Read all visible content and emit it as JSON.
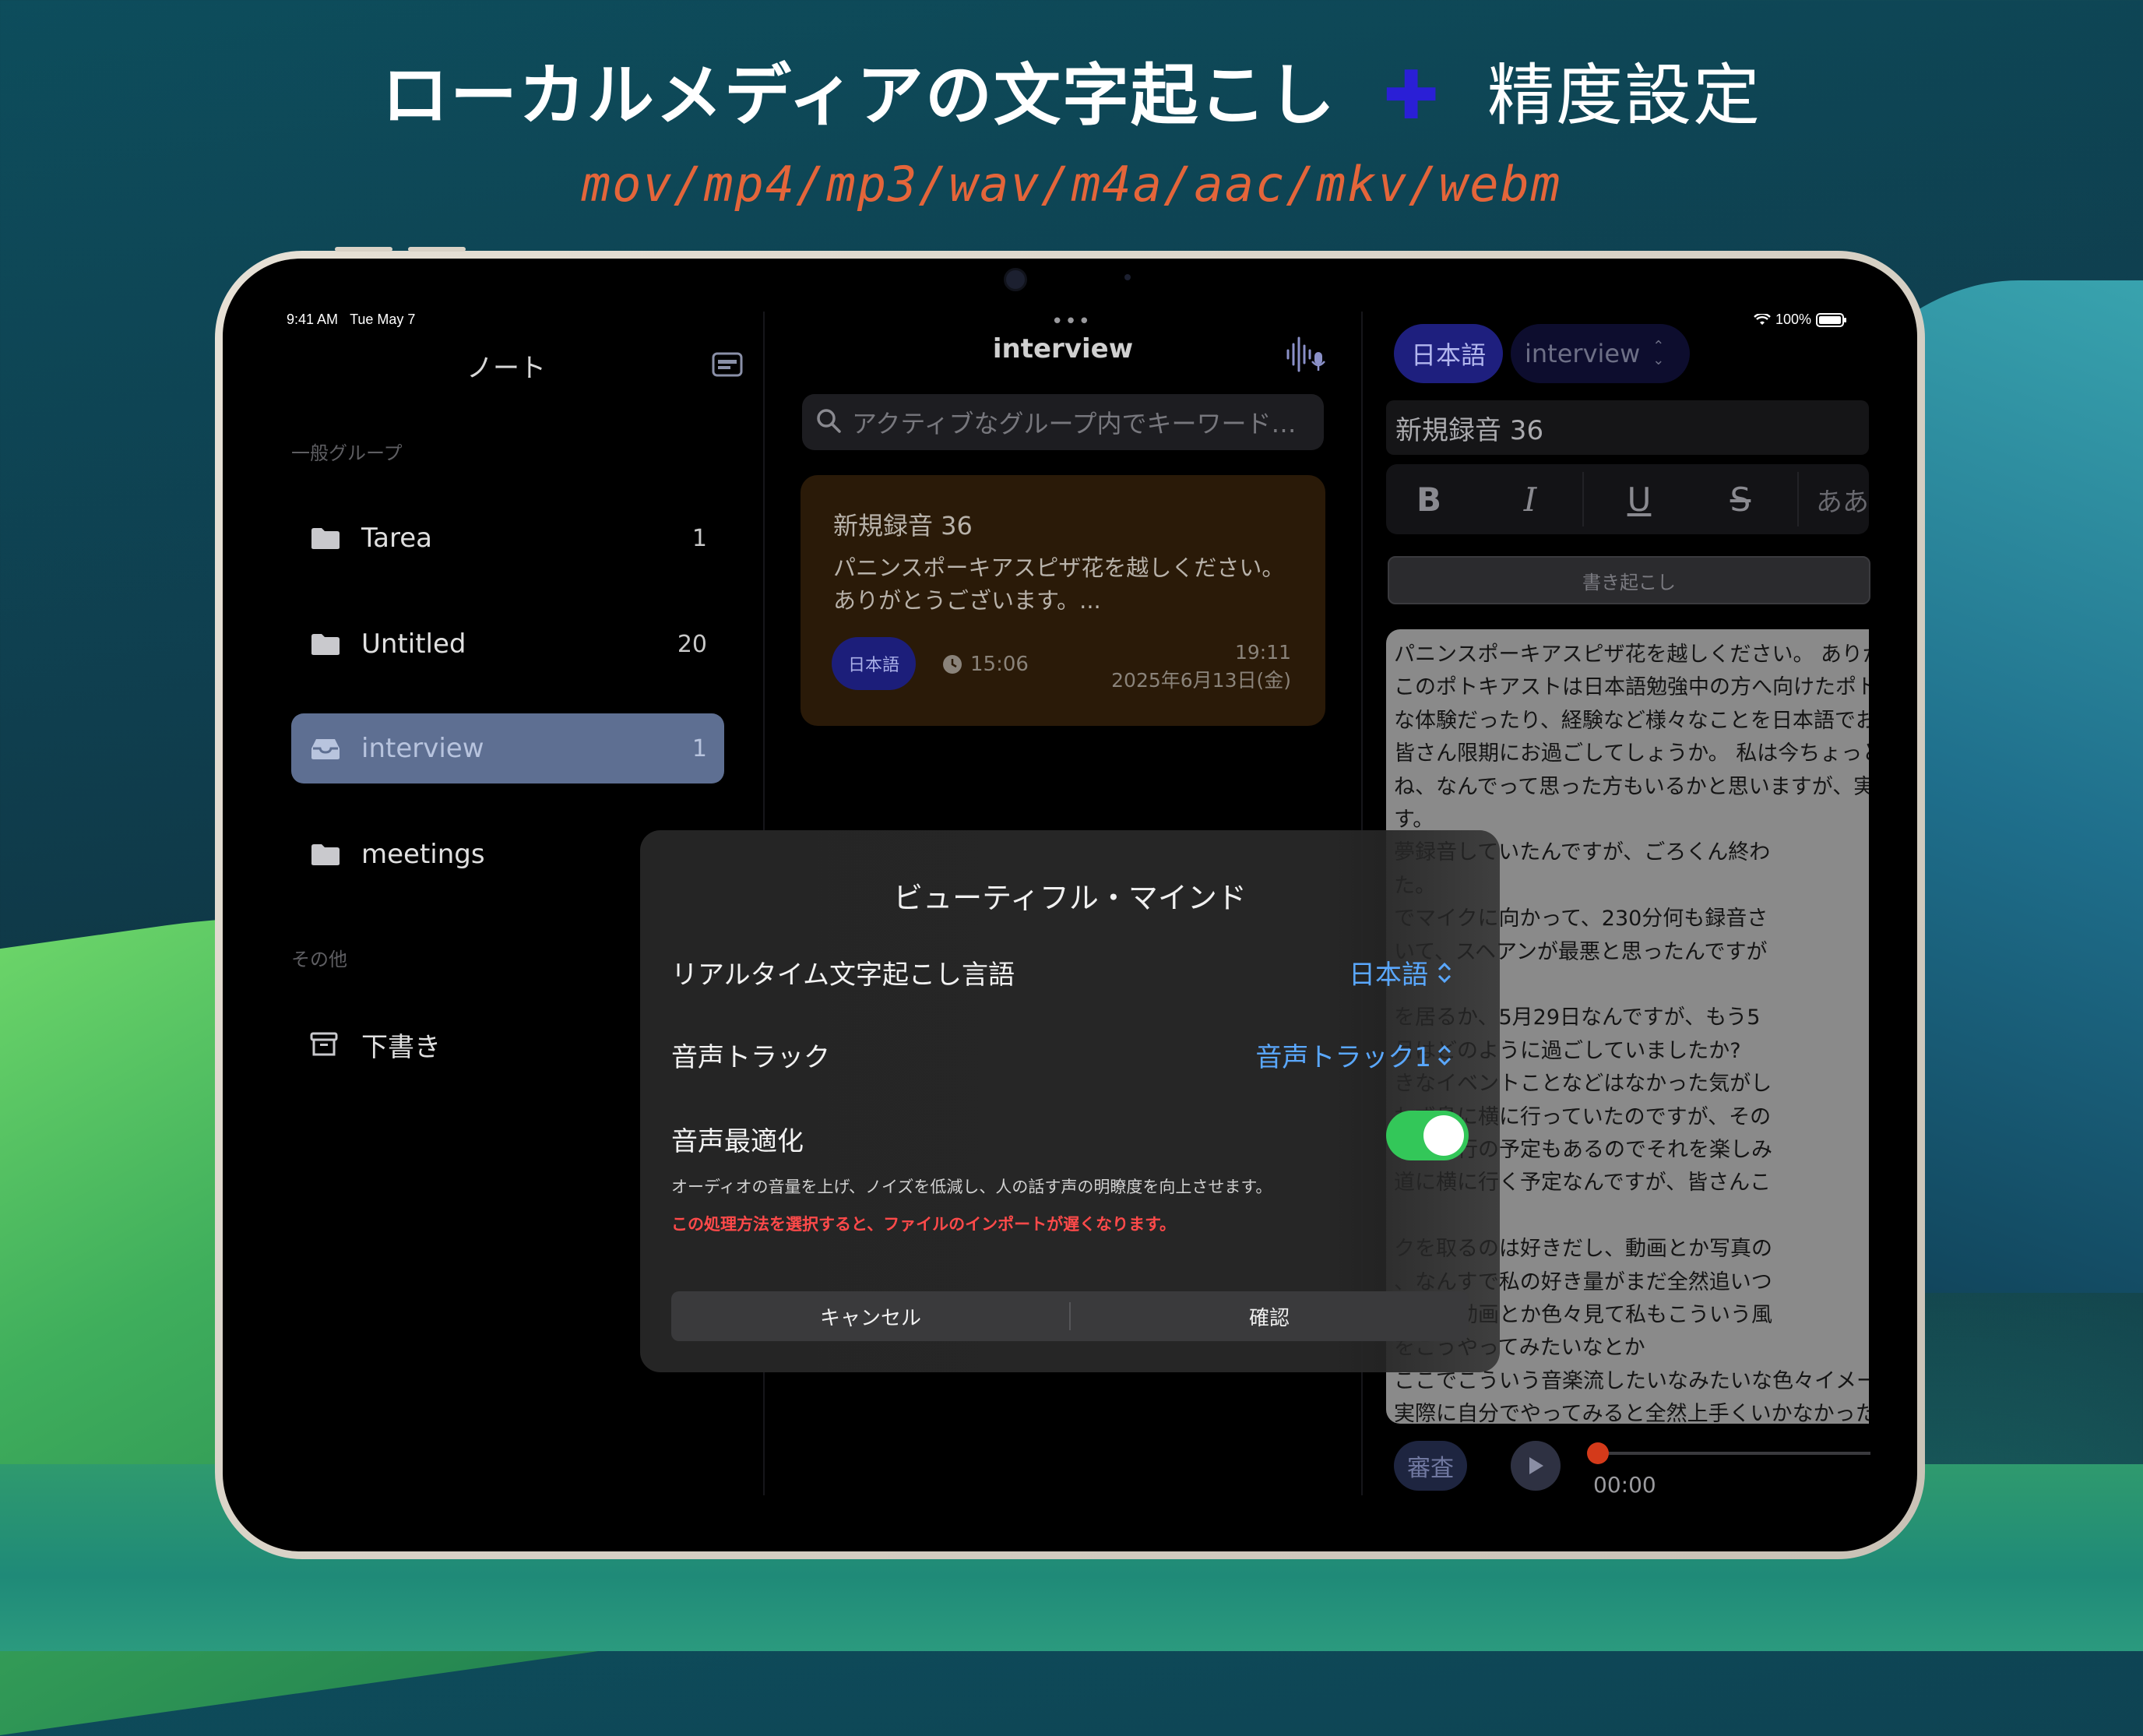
{
  "headline": {
    "main": "ローカルメディアの文字起こし",
    "plus": "✚",
    "secondary": "精度設定"
  },
  "formats": "mov/mp4/mp3/wav/m4a/aac/mkv/webm",
  "status_bar": {
    "time": "9:41 AM",
    "date": "Tue May 7",
    "battery": "100%"
  },
  "sidebar": {
    "title": "ノート",
    "general_header": "一般グループ",
    "items": [
      {
        "label": "Tarea",
        "count": "1"
      },
      {
        "label": "Untitled",
        "count": "20"
      },
      {
        "label": "interview",
        "count": "1"
      },
      {
        "label": "meetings",
        "count": ""
      }
    ],
    "other_header": "その他",
    "drafts": "下書き"
  },
  "middle": {
    "title": "interview",
    "more": "•••",
    "search_placeholder": "アクティブなグループ内でキーワード…",
    "note": {
      "title": "新規録音 36",
      "preview_1": "パニンスポーキアスピザ花を越しください。",
      "preview_2": "ありがとうございます。...",
      "language": "日本語",
      "duration": "15:06",
      "time": "19:11",
      "date": "2025年6月13日(金)"
    }
  },
  "right": {
    "language": "日本語",
    "group": "interview",
    "title": "新規録音 36",
    "format": {
      "bold": "B",
      "italic": "I",
      "underline": "U",
      "strike": "S",
      "kana": "ああ"
    },
    "transcribe_button": "書き起こし",
    "transcript": [
      "パニンスポーキアスピザ花を越しください。 ありが",
      "このポトキアストは日本語勉強中の方へ向けたポト",
      "な体験だったり、経験など様々なことを日本語でお",
      "皆さん限期にお過ごしてしょうか。 私は今ちょっと",
      "ね、なんでって思った方もいるかと思いますが、実",
      "す。",
      "夢録音していたんですが、ごろくん終わ",
      "た。",
      "でマイクに向かって、230分何も録音さ",
      "いて、スヘアンが最悪と思ったんですが",
      "",
      "を居るか、5月29日なんですが、もう5",
      "月はどのように過ごしていましたか?",
      "きなイベントことなどはなかった気がし",
      "わず島に横に行っていたのですが、その",
      "また旅行の予定もあるのでそれを楽しみ",
      "道に横に行く予定なんですが、皆さんこ",
      "",
      "クを取るのは好きだし、動画とか写真の",
      "、なんすで私の好き量がまだ全然追いつ",
      "グとか動画とか色々見て私もこういう風",
      "をこうやってみたいなとか",
      "ここでこういう音楽流したいなみたいな色々イメー",
      "実際に自分でやってみると全然上手くいかなかった"
    ],
    "review_button": "審査",
    "player_time": "00:00"
  },
  "dialog": {
    "title": "ビューティフル・マインド",
    "language_label": "リアルタイム文字起こし言語",
    "language_value": "日本語",
    "track_label": "音声トラック",
    "track_value": "音声トラック1",
    "optimize_label": "音声最適化",
    "optimize_on": true,
    "description": "オーディオの音量を上げ、ノイズを低減し、人の話す声の明瞭度を向上させます。",
    "warning": "この処理方法を選択すると、ファイルのインポートが遅くなります。",
    "cancel": "キャンセル",
    "confirm": "確認"
  },
  "colors": {
    "accent_blue": "#5aa8ff",
    "toggle_green": "#33c759",
    "warning_red": "#ff4a4a",
    "format_orange": "#e4653a",
    "headline_plus": "#2a1fd6"
  }
}
